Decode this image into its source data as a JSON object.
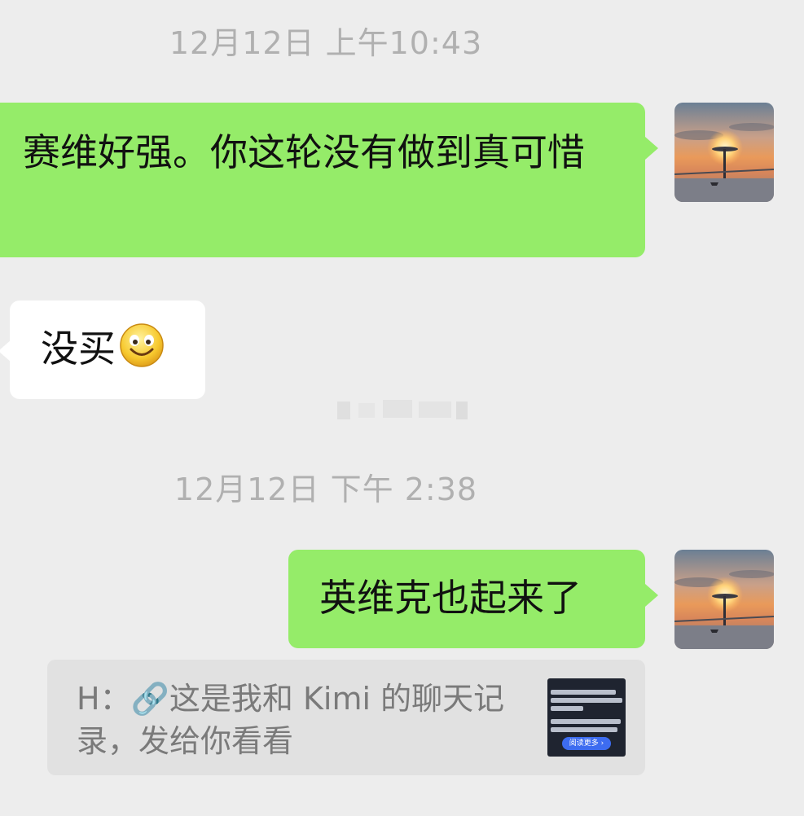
{
  "messages": {
    "timestamp_1": "12月12日 上午10:43",
    "msg_1": "赛维好强。你这轮没有做到真可惜",
    "msg_2": "没买",
    "timestamp_2": "12月12日 下午 2:38",
    "msg_3": "英维克也起来了",
    "quote_text": "H：🔗这是我和 Kimi 的聊天记录，发给你看看",
    "quote_thumb_button": "阅读更多 ›"
  },
  "icons": {
    "avatar": "sunset-bridge-avatar",
    "emoji": "smiley-emoji-icon",
    "link": "link-icon"
  },
  "colors": {
    "background": "#ededed",
    "my_bubble": "#95ec69",
    "other_bubble": "#ffffff",
    "quote_bg": "#e1e1e1",
    "timestamp": "#b0b0b0"
  }
}
